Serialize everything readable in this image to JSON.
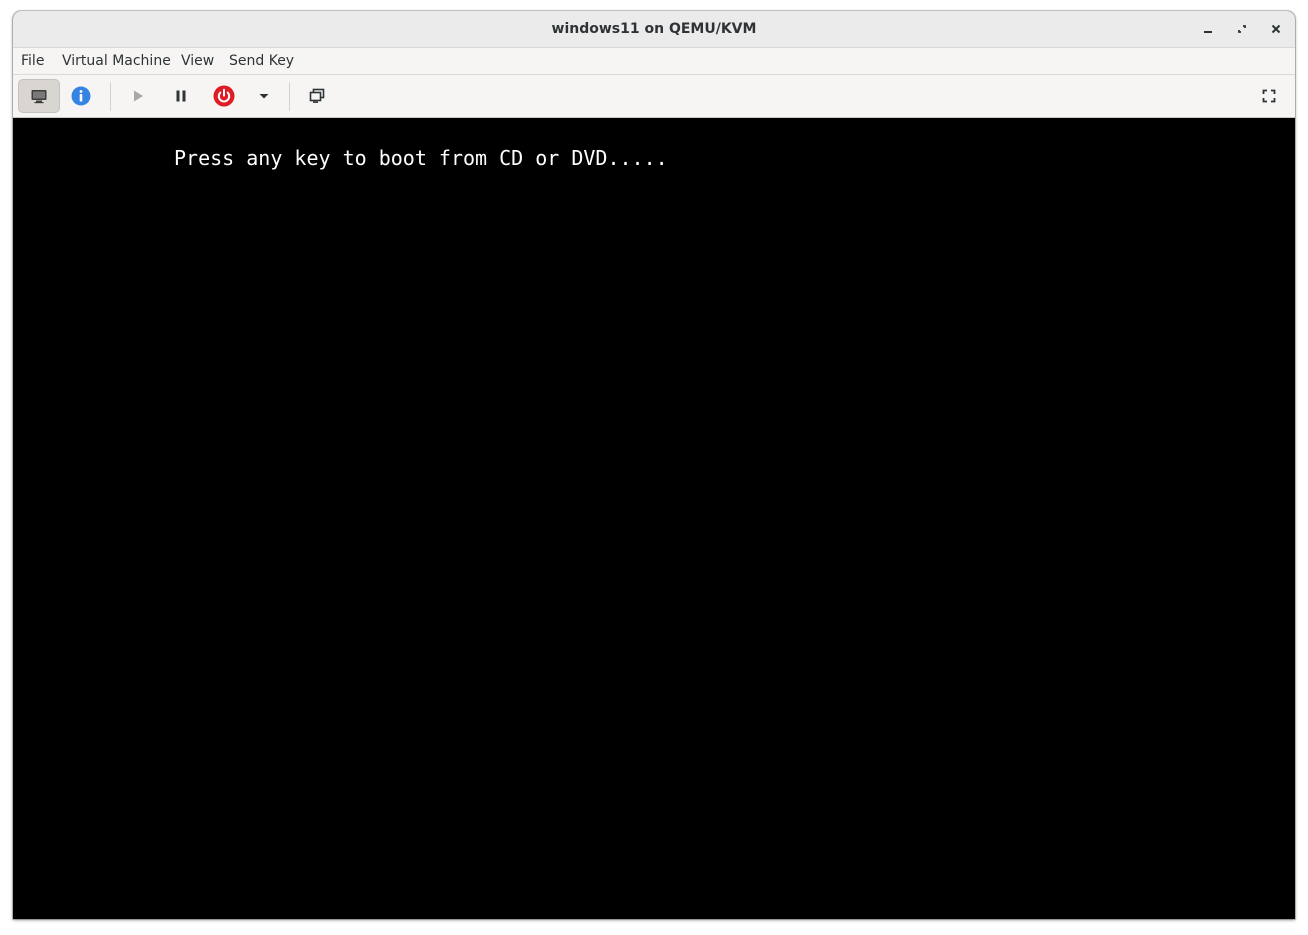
{
  "window": {
    "title": "windows11 on QEMU/KVM"
  },
  "window_controls": [
    "minimize-icon",
    "maximize-icon",
    "close-icon"
  ],
  "menubar": {
    "items": [
      "File",
      "Virtual Machine",
      "View",
      "Send Key"
    ]
  },
  "toolbar": {
    "buttons": [
      {
        "icon": "monitor-icon",
        "active": true
      },
      {
        "icon": "info-icon",
        "color": "#3584e4"
      },
      {
        "icon": "play-icon",
        "enabled": false
      },
      {
        "icon": "pause-icon"
      },
      {
        "icon": "power-icon",
        "color": "#e01b24"
      },
      {
        "icon": "chevron-down-icon"
      },
      {
        "icon": "snapshots-icon"
      },
      {
        "icon": "fullscreen-icon"
      }
    ]
  },
  "console": {
    "text": "Press any key to boot from CD or DVD....."
  },
  "colors": {
    "console_background": "#000000",
    "console_text": "#ffffff",
    "info_accent": "#3584e4",
    "power_red": "#e01b24"
  }
}
